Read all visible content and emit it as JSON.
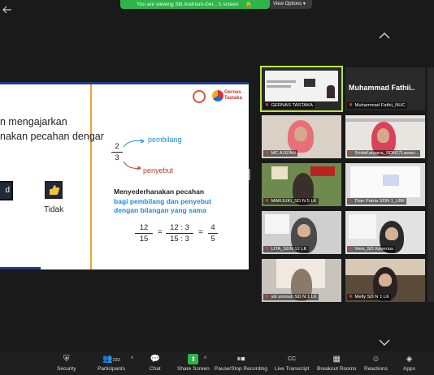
{
  "banner": {
    "text": "You are viewing Siti Andriani-Ger...'s screen",
    "view_options": "View Options"
  },
  "slide": {
    "line1": "n mengajarkan",
    "line2": "nakan pecahan dengar",
    "left_box_label": "d",
    "tidak_label": "Tidak",
    "brand": "Gernas Tastaka",
    "frac_num": "2",
    "frac_den": "3",
    "pembilang": "pembilang",
    "penyebut": "penyebut",
    "heading": "Menyederhanakan pecahan",
    "sub1": "bagi pembilang dan penyebut",
    "sub2": "dengan bilangan yang sama",
    "eq": {
      "a_num": "12",
      "a_den": "15",
      "b_num": "12 : 3",
      "b_den": "15 : 3",
      "c_num": "4",
      "c_den": "5",
      "eq_sign": "="
    }
  },
  "gallery": {
    "tiles": [
      {
        "name": "GERNAS TASTAKA",
        "kind": "slide",
        "active": true
      },
      {
        "name": "Muhammad Fathii_NUC",
        "big": "Muhammad Fathii..",
        "kind": "text"
      },
      {
        "name": "MC AJIZAH",
        "kind": "person"
      },
      {
        "name": "SridaKaryana_SDN17Lawan...",
        "kind": "person"
      },
      {
        "name": "MARJUKI_SD N 5 LK",
        "kind": "person"
      },
      {
        "name": "Dian Patria SDN 1_LBK",
        "kind": "slide"
      },
      {
        "name": "LITA_SDN 12 LK",
        "kind": "person"
      },
      {
        "name": "Vero_SD Xaverius",
        "kind": "person"
      },
      {
        "name": "siti soimah SD N 1 LK",
        "kind": "person"
      },
      {
        "name": "Melly SD N 1 LK",
        "kind": "person"
      }
    ]
  },
  "toolbar": {
    "security": "Security",
    "participants": "Participants",
    "participants_count": "232",
    "chat": "Chat",
    "share": "Share Screen",
    "record": "Pause/Stop Recording",
    "transcript": "Live Transcript",
    "breakout": "Breakout Rooms",
    "reactions": "Reactions",
    "apps": "Apps"
  }
}
